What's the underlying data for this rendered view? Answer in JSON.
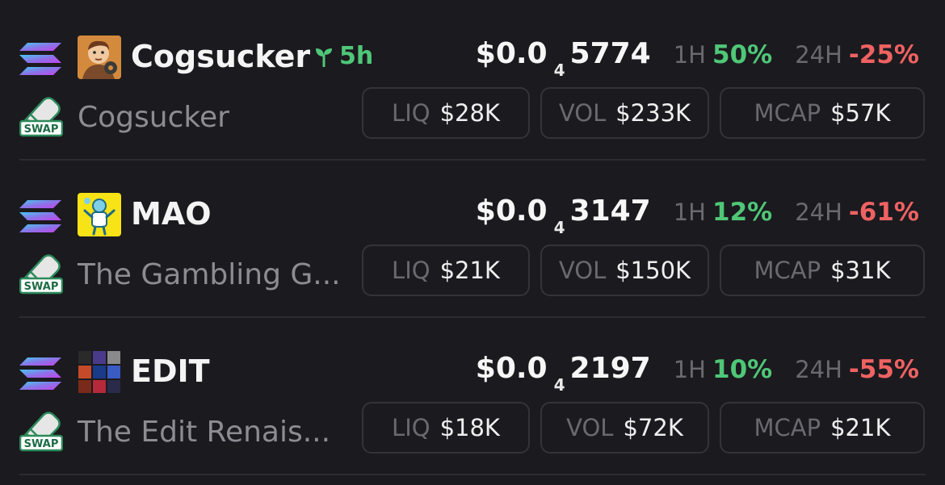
{
  "rows": [
    {
      "symbol": "Cogsucker",
      "age": "5h",
      "name": "Cogsucker",
      "price": {
        "prefix": "$0.0",
        "zeros": "4",
        "digits": "5774"
      },
      "h1": {
        "label": "1H",
        "value": "50%"
      },
      "h24": {
        "label": "24H",
        "value": "-25%"
      },
      "liq": {
        "label": "LIQ",
        "value": "$28K"
      },
      "vol": {
        "label": "VOL",
        "value": "$233K"
      },
      "mcap": {
        "label": "MCAP",
        "value": "$57K"
      }
    },
    {
      "symbol": "MAO",
      "name": "The Gambling G...",
      "price": {
        "prefix": "$0.0",
        "zeros": "4",
        "digits": "3147"
      },
      "h1": {
        "label": "1H",
        "value": "12%"
      },
      "h24": {
        "label": "24H",
        "value": "-61%"
      },
      "liq": {
        "label": "LIQ",
        "value": "$21K"
      },
      "vol": {
        "label": "VOL",
        "value": "$150K"
      },
      "mcap": {
        "label": "MCAP",
        "value": "$31K"
      }
    },
    {
      "symbol": "EDIT",
      "name": "The Edit Renais...",
      "price": {
        "prefix": "$0.0",
        "zeros": "4",
        "digits": "2197"
      },
      "h1": {
        "label": "1H",
        "value": "10%"
      },
      "h24": {
        "label": "24H",
        "value": "-55%"
      },
      "liq": {
        "label": "LIQ",
        "value": "$18K"
      },
      "vol": {
        "label": "VOL",
        "value": "$72K"
      },
      "mcap": {
        "label": "MCAP",
        "value": "$21K"
      }
    }
  ],
  "badge": {
    "swap_label": "SWAP"
  },
  "icons": {
    "chain": "solana-icon",
    "swap": "swap-badge-icon",
    "age": "sprout-icon"
  },
  "colors": {
    "positive": "#4fc777",
    "negative": "#ef6262",
    "background": "#1b1a1f"
  }
}
